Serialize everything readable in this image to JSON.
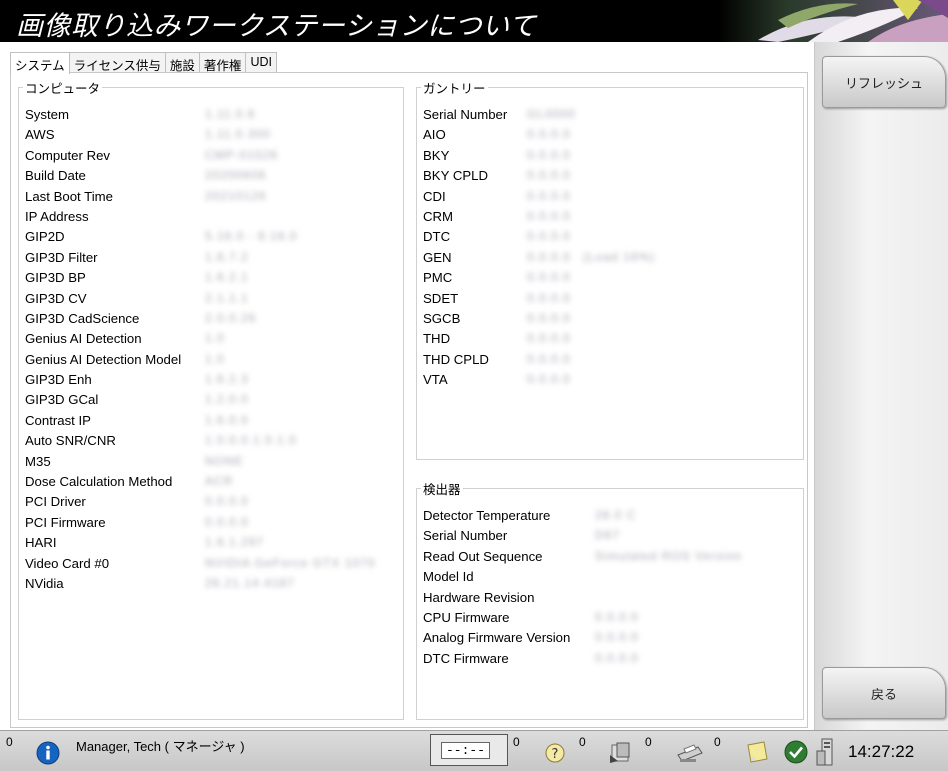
{
  "window": {
    "title": "画像取り込みワークステーションについて"
  },
  "tabs": [
    {
      "label": "システム",
      "active": true
    },
    {
      "label": "ライセンス供与",
      "active": false
    },
    {
      "label": "施設",
      "active": false
    },
    {
      "label": "著作権",
      "active": false
    },
    {
      "label": "UDI",
      "active": false
    }
  ],
  "computer": {
    "legend": "コンピュータ",
    "rows": [
      {
        "label": "System",
        "value": "1.11.0.6"
      },
      {
        "label": "AWS",
        "value": "1.11.0.300"
      },
      {
        "label": "Computer Rev",
        "value": "CMP-01526"
      },
      {
        "label": "Build Date",
        "value": "20200606"
      },
      {
        "label": "Last Boot Time",
        "value": "20210126"
      },
      {
        "label": "IP Address",
        "value": ""
      },
      {
        "label": "GIP2D",
        "value": "5.16.0 - 8.16.0"
      },
      {
        "label": "GIP3D Filter",
        "value": "1.6.7.2"
      },
      {
        "label": "GIP3D BP",
        "value": "1.6.2.1"
      },
      {
        "label": "GIP3D CV",
        "value": "2.1.1.1"
      },
      {
        "label": "GIP3D CadScience",
        "value": "2.0.0.26"
      },
      {
        "label": "Genius AI Detection",
        "value": "1.0"
      },
      {
        "label": "Genius AI Detection Model",
        "value": "1.0"
      },
      {
        "label": "GIP3D Enh",
        "value": "1.6.2.3"
      },
      {
        "label": "GIP3D GCal",
        "value": "1.2.0.0"
      },
      {
        "label": "Contrast IP",
        "value": "1.6.0.0"
      },
      {
        "label": "Auto SNR/CNR",
        "value": "1.0.0.0.1.0.1.0"
      },
      {
        "label": "M35",
        "value": "NONE"
      },
      {
        "label": "Dose Calculation Method",
        "value": "ACR"
      },
      {
        "label": "PCI Driver",
        "value": "0.0.0.0"
      },
      {
        "label": "PCI Firmware",
        "value": "0.0.0.0"
      },
      {
        "label": "HARI",
        "value": "1.6.1.297"
      },
      {
        "label": "Video Card #0",
        "value": "NVIDIA GeForce GTX 1070"
      },
      {
        "label": "NVidia",
        "value": "26.21.14.4187"
      }
    ]
  },
  "gantry": {
    "legend": "ガントリー",
    "rows": [
      {
        "label": "Serial Number",
        "value": "GL0000"
      },
      {
        "label": "AIO",
        "value": "0.0.0.0"
      },
      {
        "label": "BKY",
        "value": "0.0.0.0"
      },
      {
        "label": "BKY CPLD",
        "value": "0.0.0.0"
      },
      {
        "label": "CDI",
        "value": "0.0.0.0"
      },
      {
        "label": "CRM",
        "value": "0.0.0.0"
      },
      {
        "label": "DTC",
        "value": "0.0.0.0"
      },
      {
        "label": "GEN",
        "value": "0.0.0.0",
        "extra": "(Load 16%)"
      },
      {
        "label": "PMC",
        "value": "0.0.0.0"
      },
      {
        "label": "SDET",
        "value": "0.0.0.0"
      },
      {
        "label": "SGCB",
        "value": "0.0.0.0"
      },
      {
        "label": "THD",
        "value": "0.0.0.0"
      },
      {
        "label": "THD CPLD",
        "value": "0.0.0.0"
      },
      {
        "label": "VTA",
        "value": "0.0.0.0"
      }
    ]
  },
  "detector": {
    "legend": "検出器",
    "rows": [
      {
        "label": "Detector Temperature",
        "value": "28.0 C"
      },
      {
        "label": "Serial Number",
        "value": "D67"
      },
      {
        "label": "Read Out Sequence",
        "value": "Simulated ROS Version"
      },
      {
        "label": "Model Id",
        "value": ""
      },
      {
        "label": "Hardware Revision",
        "value": ""
      },
      {
        "label": "CPU Firmware",
        "value": "0.0.0.0"
      },
      {
        "label": "Analog Firmware Version",
        "value": "0.0.0.0"
      },
      {
        "label": "DTC Firmware",
        "value": "0.0.0.0"
      }
    ]
  },
  "sidebar": {
    "refresh_label": "リフレッシュ",
    "back_label": "戻る"
  },
  "taskbar": {
    "alert_count": "0",
    "user": "Manager, Tech ( マネージャ )",
    "lcd_text": "--:--",
    "count_lcd": "0",
    "count_help": "0",
    "count_film": "0",
    "count_print": "0",
    "clock": "14:27:22"
  },
  "colors": {
    "title_bg": "#000000",
    "info_icon": "#1565c0",
    "check_icon": "#2e7d32"
  }
}
